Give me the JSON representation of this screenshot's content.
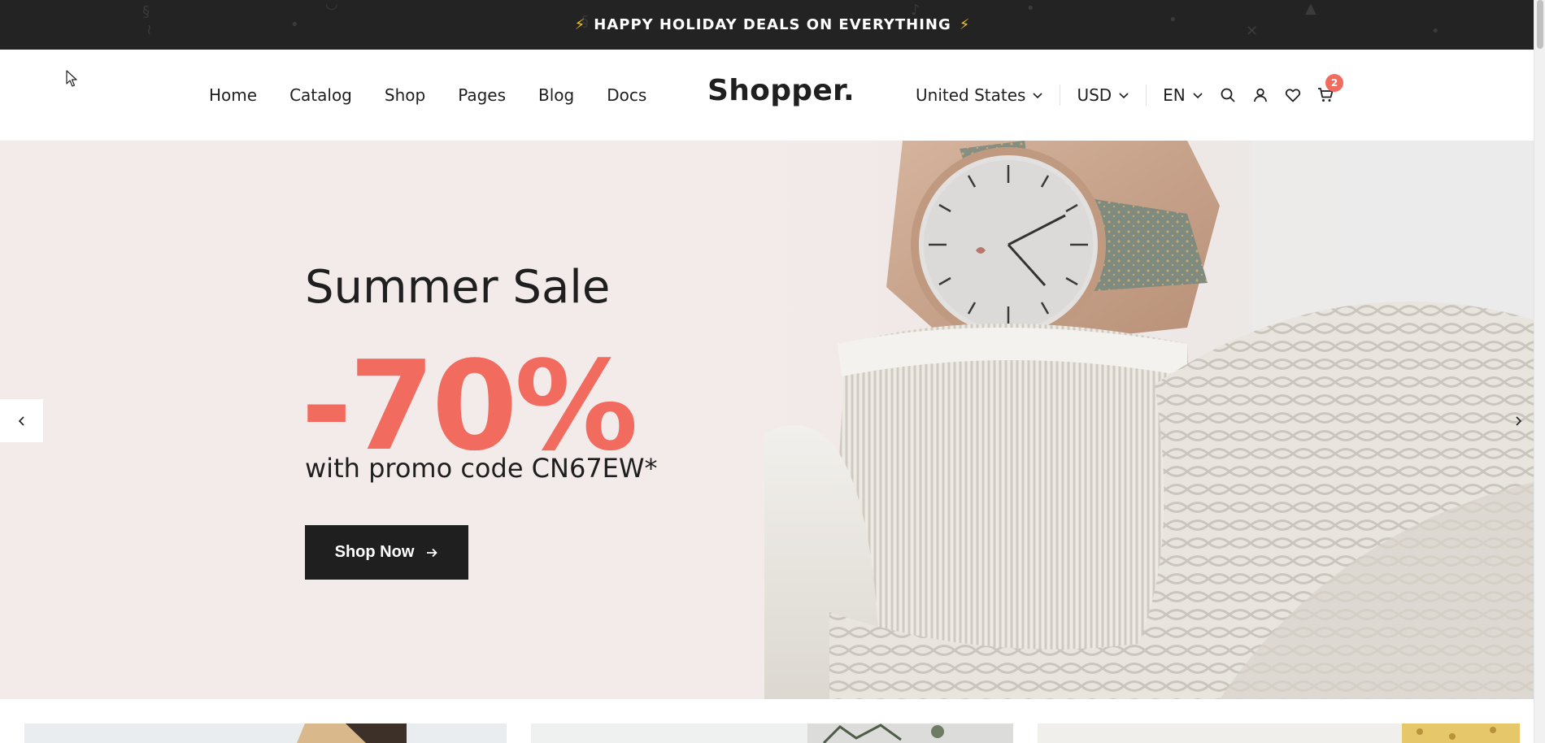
{
  "announcement": {
    "text": "HAPPY HOLIDAY DEALS ON EVERYTHING",
    "icon": "lightning-bolt-icon"
  },
  "header": {
    "nav": [
      {
        "label": "Home"
      },
      {
        "label": "Catalog"
      },
      {
        "label": "Shop"
      },
      {
        "label": "Pages"
      },
      {
        "label": "Blog"
      },
      {
        "label": "Docs"
      }
    ],
    "logo": "Shopper.",
    "country": "United States",
    "currency": "USD",
    "language": "EN",
    "icons": [
      "search-icon",
      "user-icon",
      "heart-icon",
      "cart-icon"
    ],
    "cart_count": "2"
  },
  "hero": {
    "title": "Summer Sale",
    "discount": "-70%",
    "promo": "with promo code CN67EW*",
    "button_label": "Shop Now",
    "image": "watch-on-wrist-knit-sweater-photo"
  },
  "colors": {
    "accent": "#f16b5f",
    "dark": "#1f1f1f",
    "topbar": "#232323",
    "hero_bg": "#f3ebea"
  }
}
